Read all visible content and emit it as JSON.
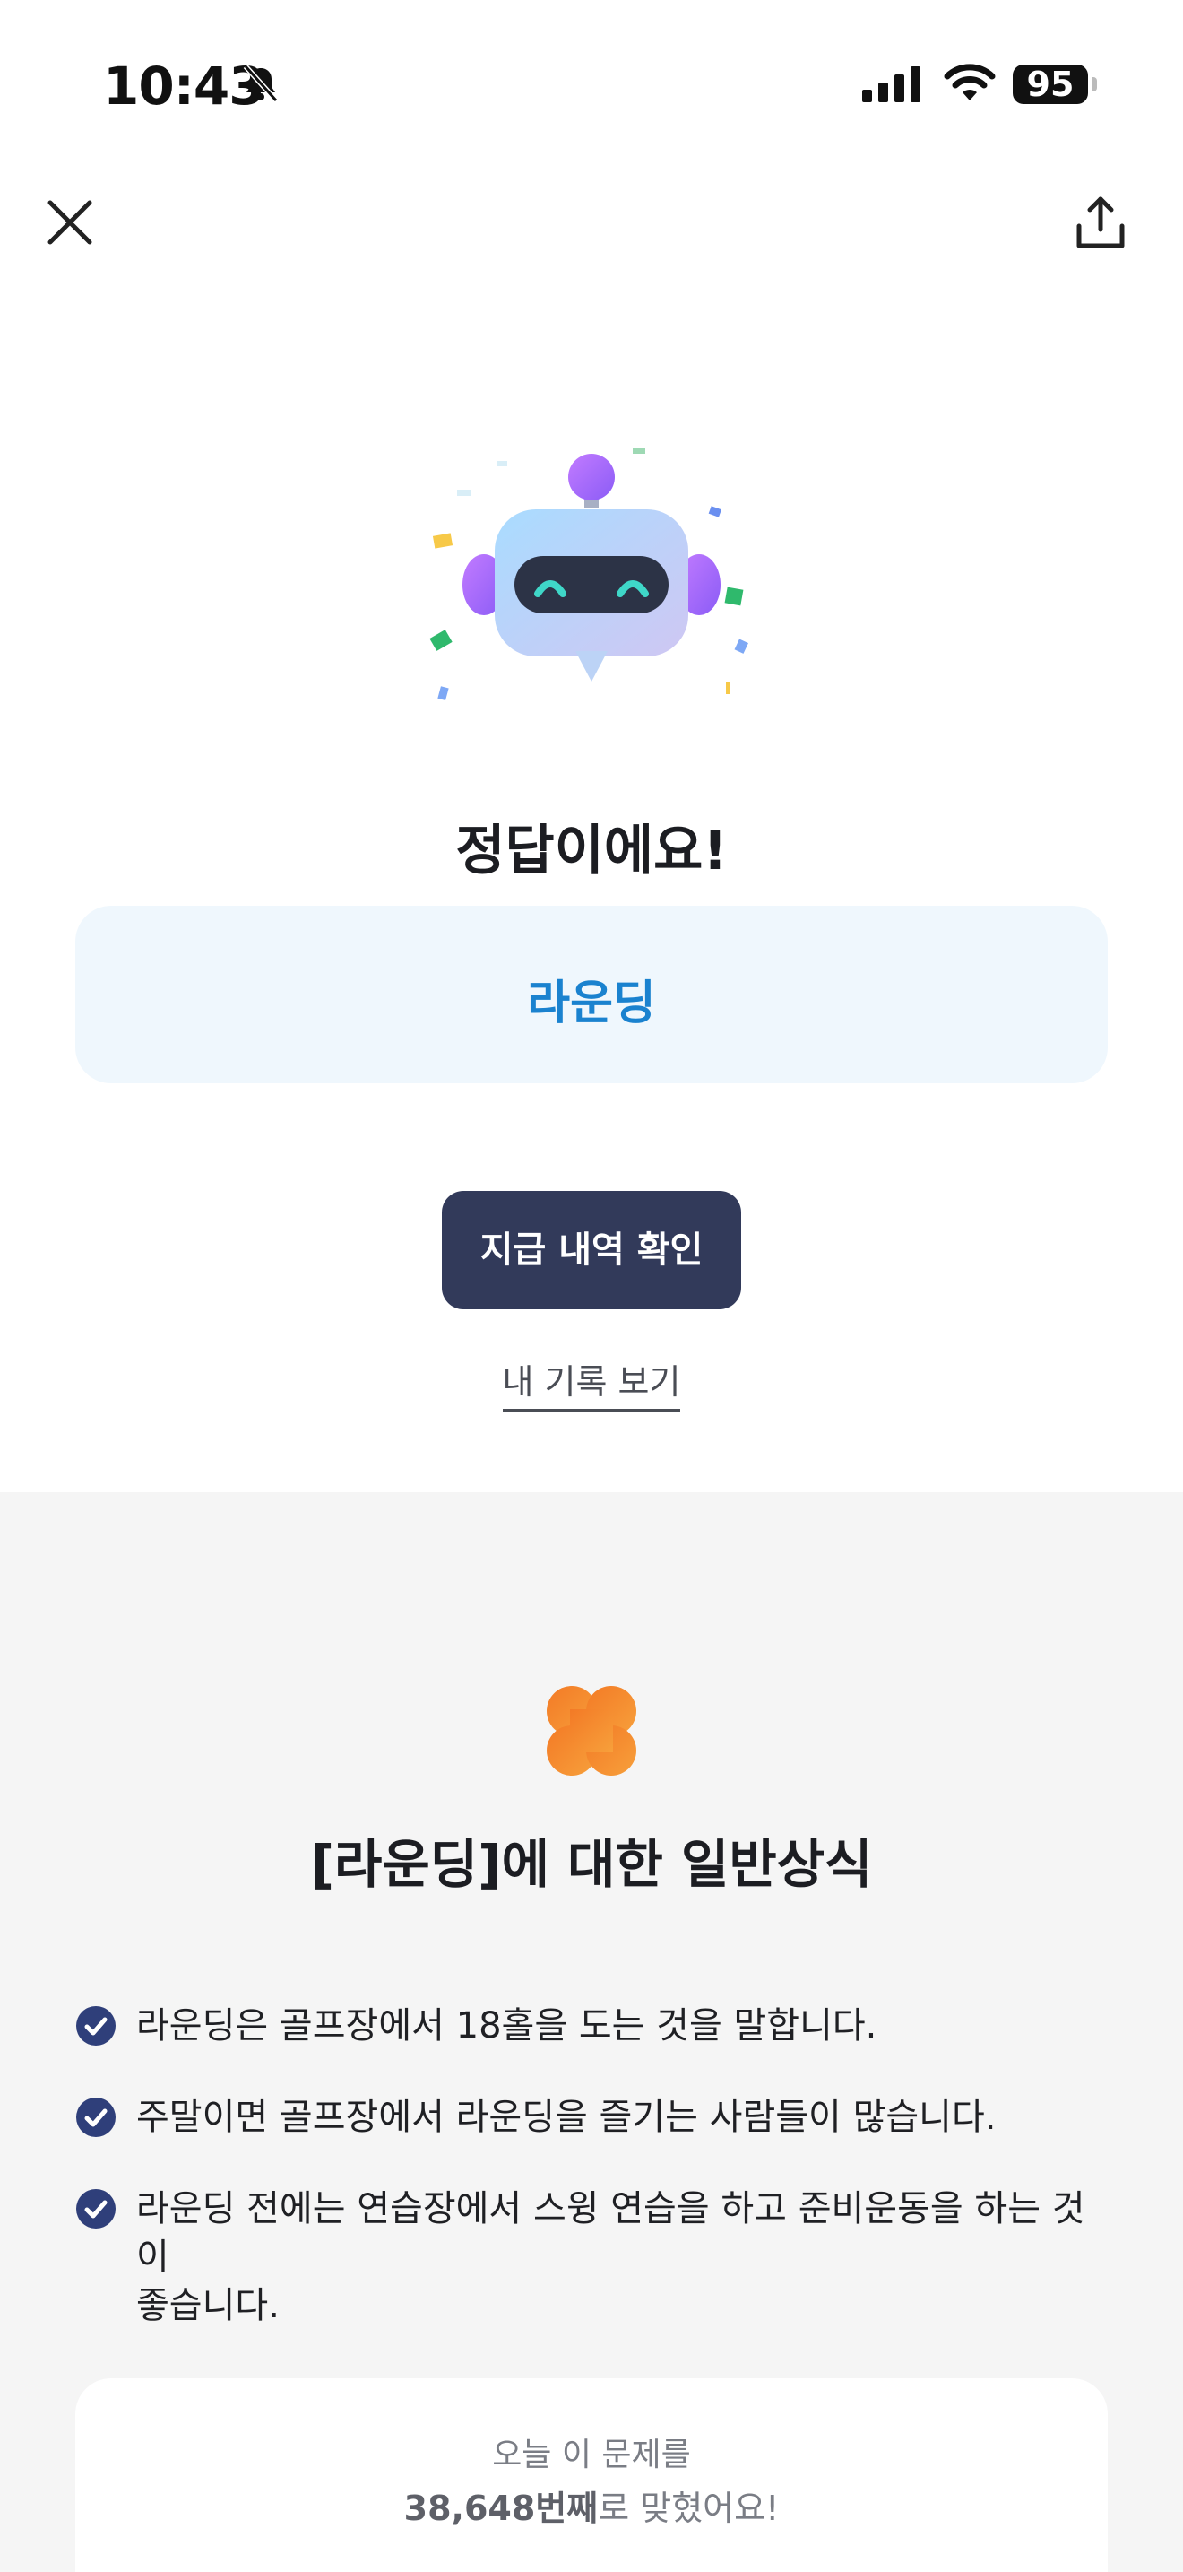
{
  "status_bar": {
    "time": "10:43",
    "battery": "95"
  },
  "result": {
    "heading": "정답이에요!",
    "answer": "라운딩"
  },
  "actions": {
    "primary_label": "지급 내역 확인",
    "record_link": "내 기록 보기"
  },
  "trivia": {
    "title": "[라운딩]에 대한 일반상식",
    "facts": [
      "라운딩은 골프장에서 18홀을 도는 것을 말합니다.",
      "주말이면 골프장에서 라운딩을 즐기는 사람들이 많습니다.",
      "라운딩 전에는 연습장에서 스윙 연습을 하고 준비운동을 하는 것이",
      "좋습니다."
    ]
  },
  "stats": {
    "line1": "오늘 이 문제를",
    "count": "38,648번째",
    "suffix": "로 맞혔어요!"
  },
  "colors": {
    "accent_blue": "#1a82cf",
    "button_navy": "#323a5a",
    "check_navy": "#2f3f7a",
    "clover_orange": "#f2862d"
  }
}
